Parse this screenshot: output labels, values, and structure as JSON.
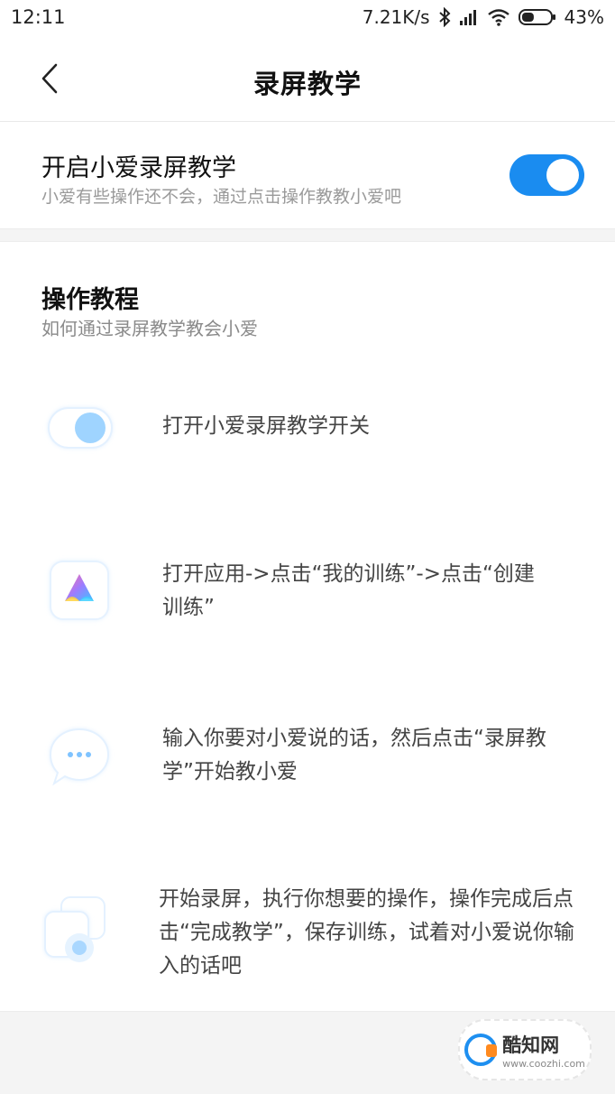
{
  "status_bar": {
    "time": "12:11",
    "speed": "7.21K/s",
    "battery": "43%",
    "battery_level": 0.43,
    "icons": [
      "bluetooth-icon",
      "signal-icon",
      "wifi-icon",
      "battery-icon"
    ]
  },
  "header": {
    "title": "录屏教学",
    "back_icon": "chevron-left-icon"
  },
  "toggle": {
    "title": "开启小爱录屏教学",
    "subtitle": "小爱有些操作还不会，通过点击操作教教小爱吧",
    "enabled": true,
    "accent_color": "#1a8cf0"
  },
  "tutorial": {
    "title": "操作教程",
    "subtitle": "如何通过录屏教学教会小爱",
    "steps": [
      {
        "icon": "toggle-switch-icon",
        "text": "打开小爱录屏教学开关"
      },
      {
        "icon": "app-logo-icon",
        "text": "打开应用->点击“我的训练”->点击“创建训练”"
      },
      {
        "icon": "chat-bubble-icon",
        "text": "输入你要对小爱说的话，然后点击“录屏教学”开始教小爱"
      },
      {
        "icon": "screen-record-icon",
        "text": "开始录屏，执行你想要的操作，操作完成后点击“完成教学”，保存训练，试着对小爱说你输入的话吧"
      }
    ]
  },
  "watermark": {
    "name": "酷知网",
    "url": "www.coozhi.com"
  }
}
